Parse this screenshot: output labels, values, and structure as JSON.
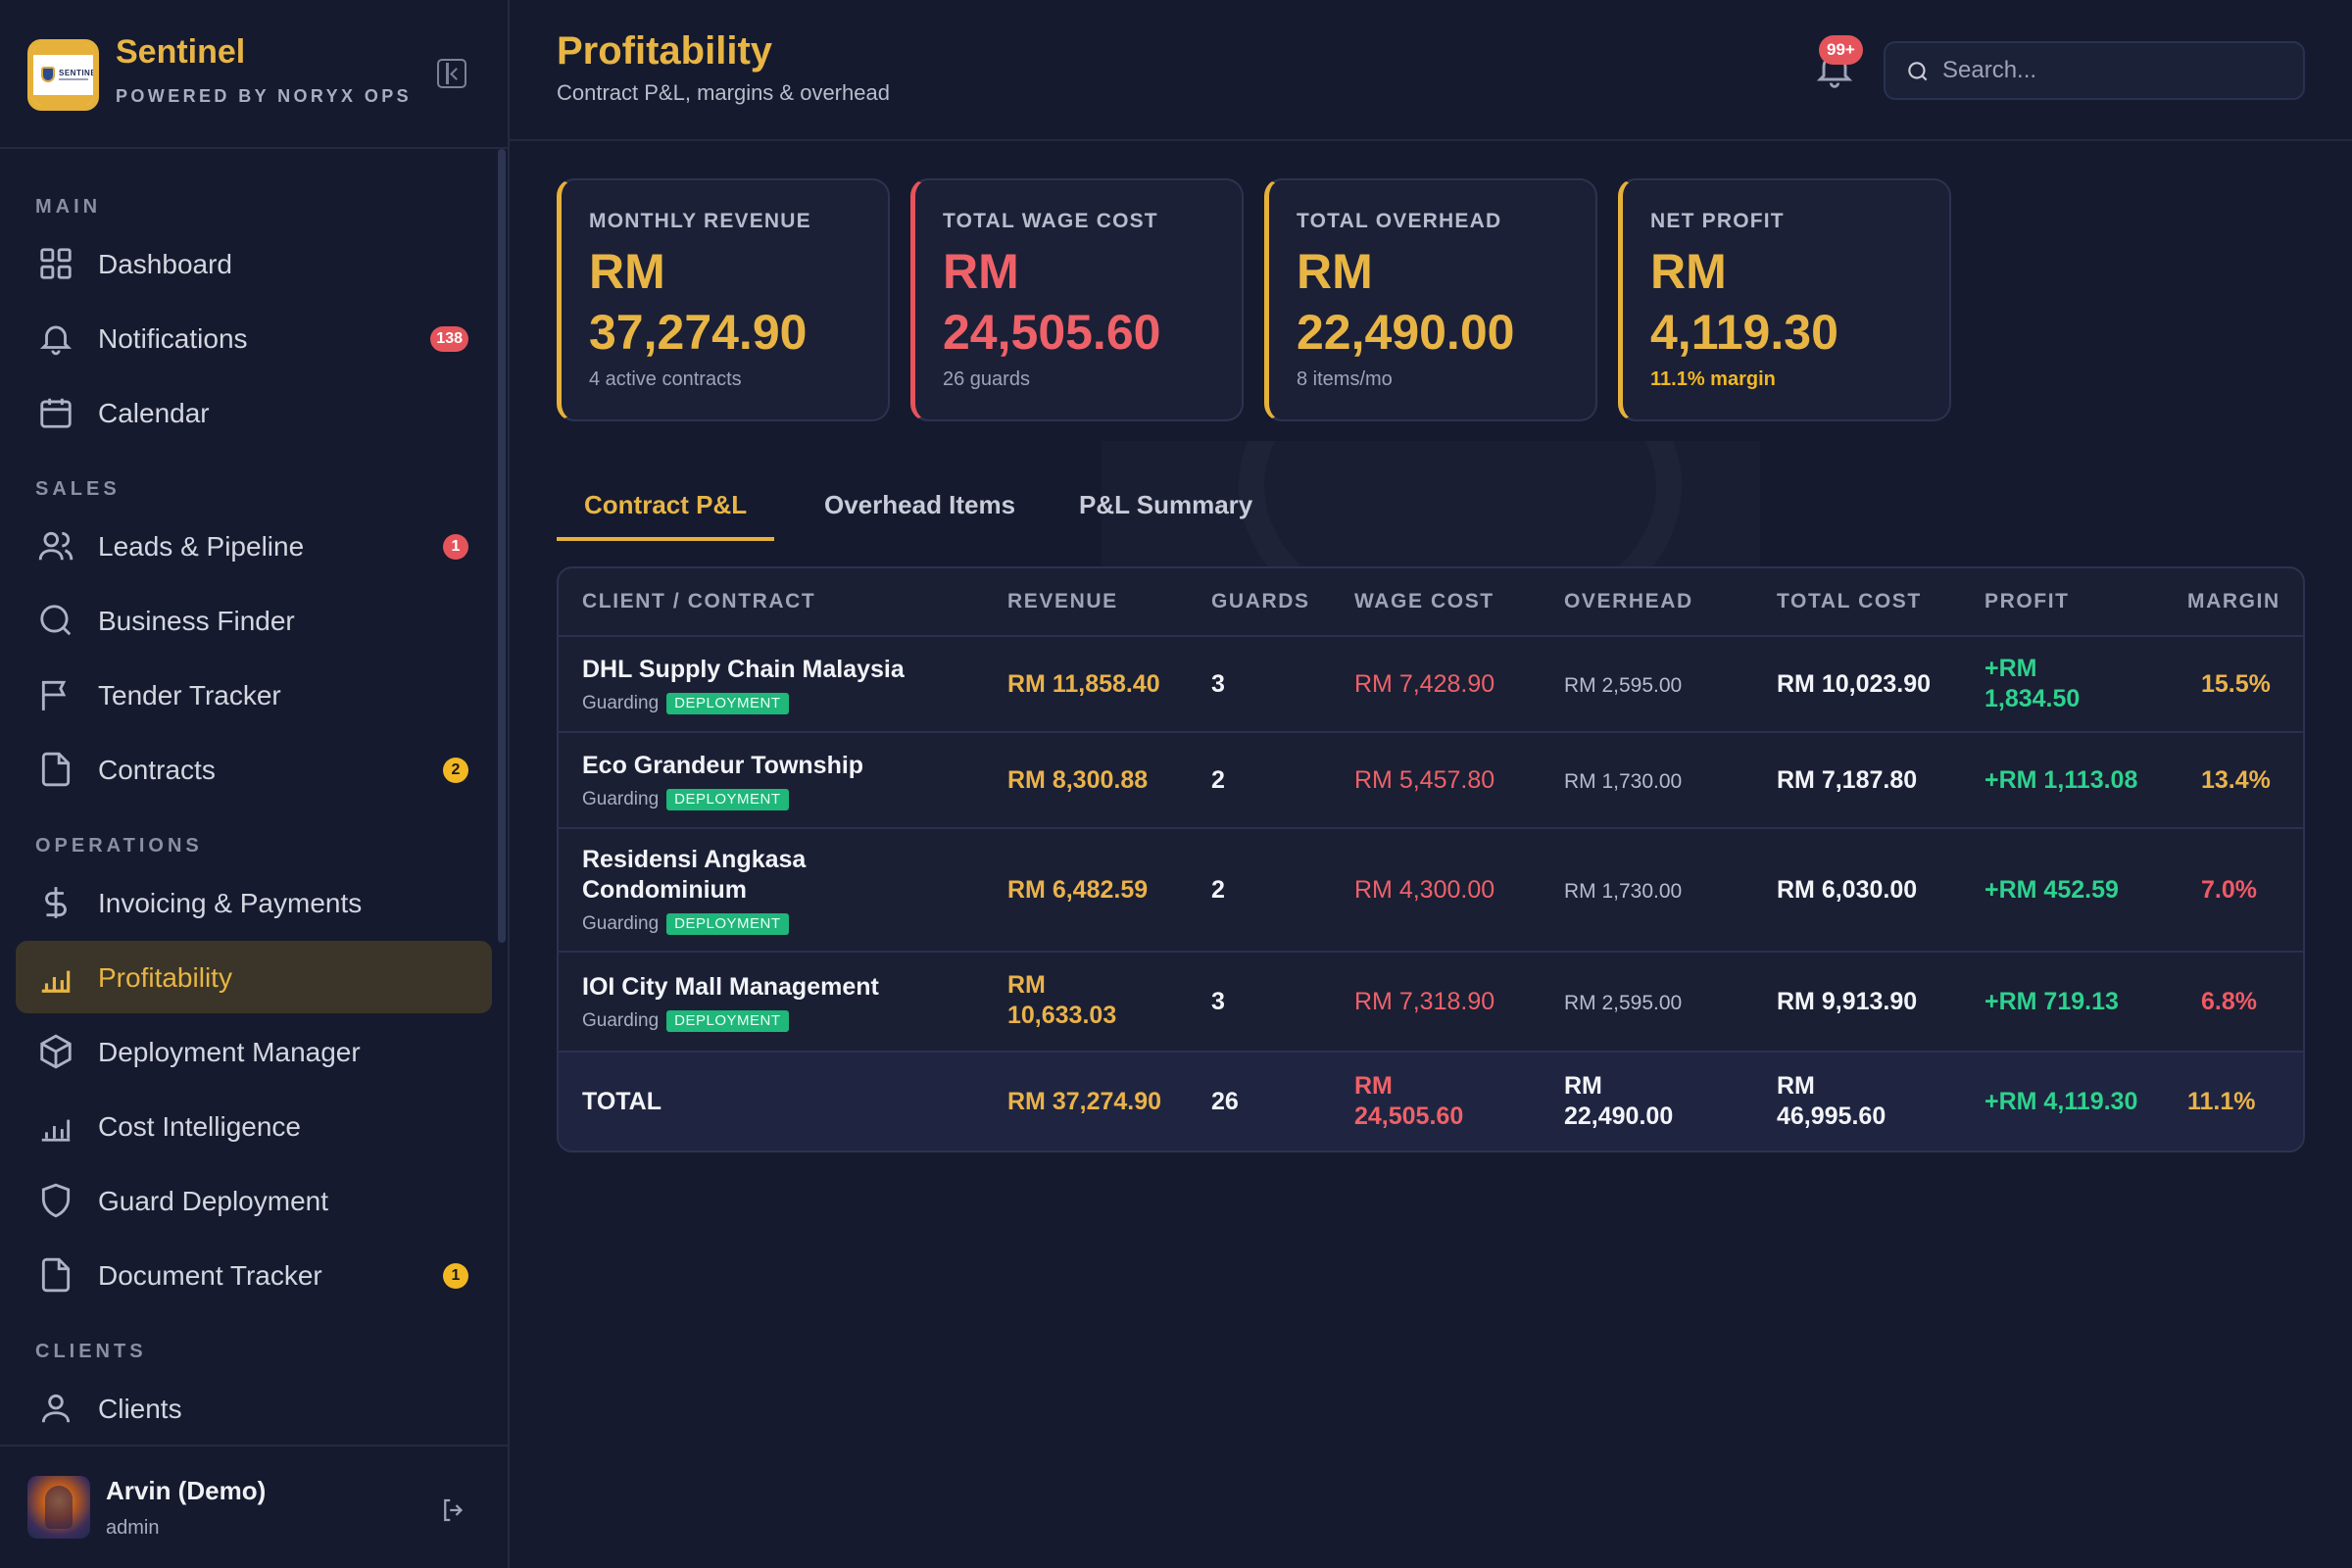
{
  "brand": {
    "name": "Sentinel",
    "subtitle": "POWERED BY NORYX OPS",
    "logo_text": "SENTINEL"
  },
  "nav": {
    "sections": [
      "MAIN",
      "SALES",
      "OPERATIONS",
      "CLIENTS"
    ],
    "items": [
      {
        "label": "Dashboard",
        "icon": "grid-icon"
      },
      {
        "label": "Notifications",
        "icon": "bell-icon",
        "badge": "138"
      },
      {
        "label": "Calendar",
        "icon": "calendar-icon"
      },
      {
        "label": "Leads & Pipeline",
        "icon": "users-icon",
        "badge": "1"
      },
      {
        "label": "Business Finder",
        "icon": "search-icon"
      },
      {
        "label": "Tender Tracker",
        "icon": "flag-icon"
      },
      {
        "label": "Contracts",
        "icon": "file-icon",
        "badge": "2"
      },
      {
        "label": "Invoicing & Payments",
        "icon": "dollar-icon"
      },
      {
        "label": "Profitability",
        "icon": "bar-chart-icon",
        "active": true
      },
      {
        "label": "Deployment Manager",
        "icon": "box-icon"
      },
      {
        "label": "Cost Intelligence",
        "icon": "bar-chart-icon"
      },
      {
        "label": "Guard Deployment",
        "icon": "shield-icon"
      },
      {
        "label": "Document Tracker",
        "icon": "file-icon",
        "badge": "1"
      },
      {
        "label": "Clients",
        "icon": "user-icon"
      }
    ]
  },
  "user": {
    "name": "Arvin (Demo)",
    "role": "admin"
  },
  "header": {
    "title": "Profitability",
    "subtitle": "Contract P&L, margins & overhead",
    "notification_badge": "99+",
    "search_placeholder": "Search..."
  },
  "kpis": [
    {
      "label": "MONTHLY REVENUE",
      "currency": "RM",
      "value": "37,274.90",
      "note": "4 active contracts",
      "tone": "gold"
    },
    {
      "label": "TOTAL WAGE COST",
      "currency": "RM",
      "value": "24,505.60",
      "note": "26 guards",
      "tone": "red"
    },
    {
      "label": "TOTAL OVERHEAD",
      "currency": "RM",
      "value": "22,490.00",
      "note": "8 items/mo",
      "tone": "gold"
    },
    {
      "label": "NET PROFIT",
      "currency": "RM",
      "value": "4,119.30",
      "note": "11.1% margin",
      "tone": "gold"
    }
  ],
  "tabs": [
    "Contract P&L",
    "Overhead Items",
    "P&L Summary"
  ],
  "table": {
    "columns": [
      "CLIENT / CONTRACT",
      "REVENUE",
      "GUARDS",
      "WAGE COST",
      "OVERHEAD",
      "TOTAL COST",
      "PROFIT",
      "MARGIN"
    ],
    "rows": [
      {
        "name": "DHL Supply Chain Malaysia",
        "type": "Guarding",
        "badge": "DEPLOYMENT",
        "revenue": "RM 11,858.40",
        "guards": "3",
        "wage": "RM 7,428.90",
        "overhead": "RM 2,595.00",
        "total_cost": "RM 10,023.90",
        "profit_l1": "+RM",
        "profit_l2": "1,834.50",
        "margin": "15.5%"
      },
      {
        "name": "Eco Grandeur Township",
        "type": "Guarding",
        "badge": "DEPLOYMENT",
        "revenue": "RM 8,300.88",
        "guards": "2",
        "wage": "RM 5,457.80",
        "overhead": "RM 1,730.00",
        "total_cost": "RM 7,187.80",
        "profit": "+RM 1,113.08",
        "margin": "13.4%"
      },
      {
        "name_l1": "Residensi Angkasa",
        "name_l2": "Condominium",
        "type": "Guarding",
        "badge": "DEPLOYMENT",
        "revenue": "RM 6,482.59",
        "guards": "2",
        "wage": "RM 4,300.00",
        "overhead": "RM 1,730.00",
        "total_cost": "RM 6,030.00",
        "profit": "+RM 452.59",
        "margin": "7.0%"
      },
      {
        "name": "IOI City Mall Management",
        "type": "Guarding",
        "badge": "DEPLOYMENT",
        "revenue_l1": "RM",
        "revenue_l2": "10,633.03",
        "guards": "3",
        "wage": "RM 7,318.90",
        "overhead": "RM 2,595.00",
        "total_cost": "RM 9,913.90",
        "profit": "+RM 719.13",
        "margin": "6.8%"
      }
    ],
    "total": {
      "label": "TOTAL",
      "revenue": "RM 37,274.90",
      "guards": "26",
      "wage_l1": "RM",
      "wage_l2": "24,505.60",
      "overhead_l1": "RM",
      "overhead_l2": "22,490.00",
      "total_cost_l1": "RM",
      "total_cost_l2": "46,995.60",
      "profit": "+RM 4,119.30",
      "margin": "11.1%"
    }
  },
  "colors": {
    "accent": "#e8b545",
    "danger": "#ef6168",
    "success": "#2ed28e",
    "background": "#151a2e"
  }
}
